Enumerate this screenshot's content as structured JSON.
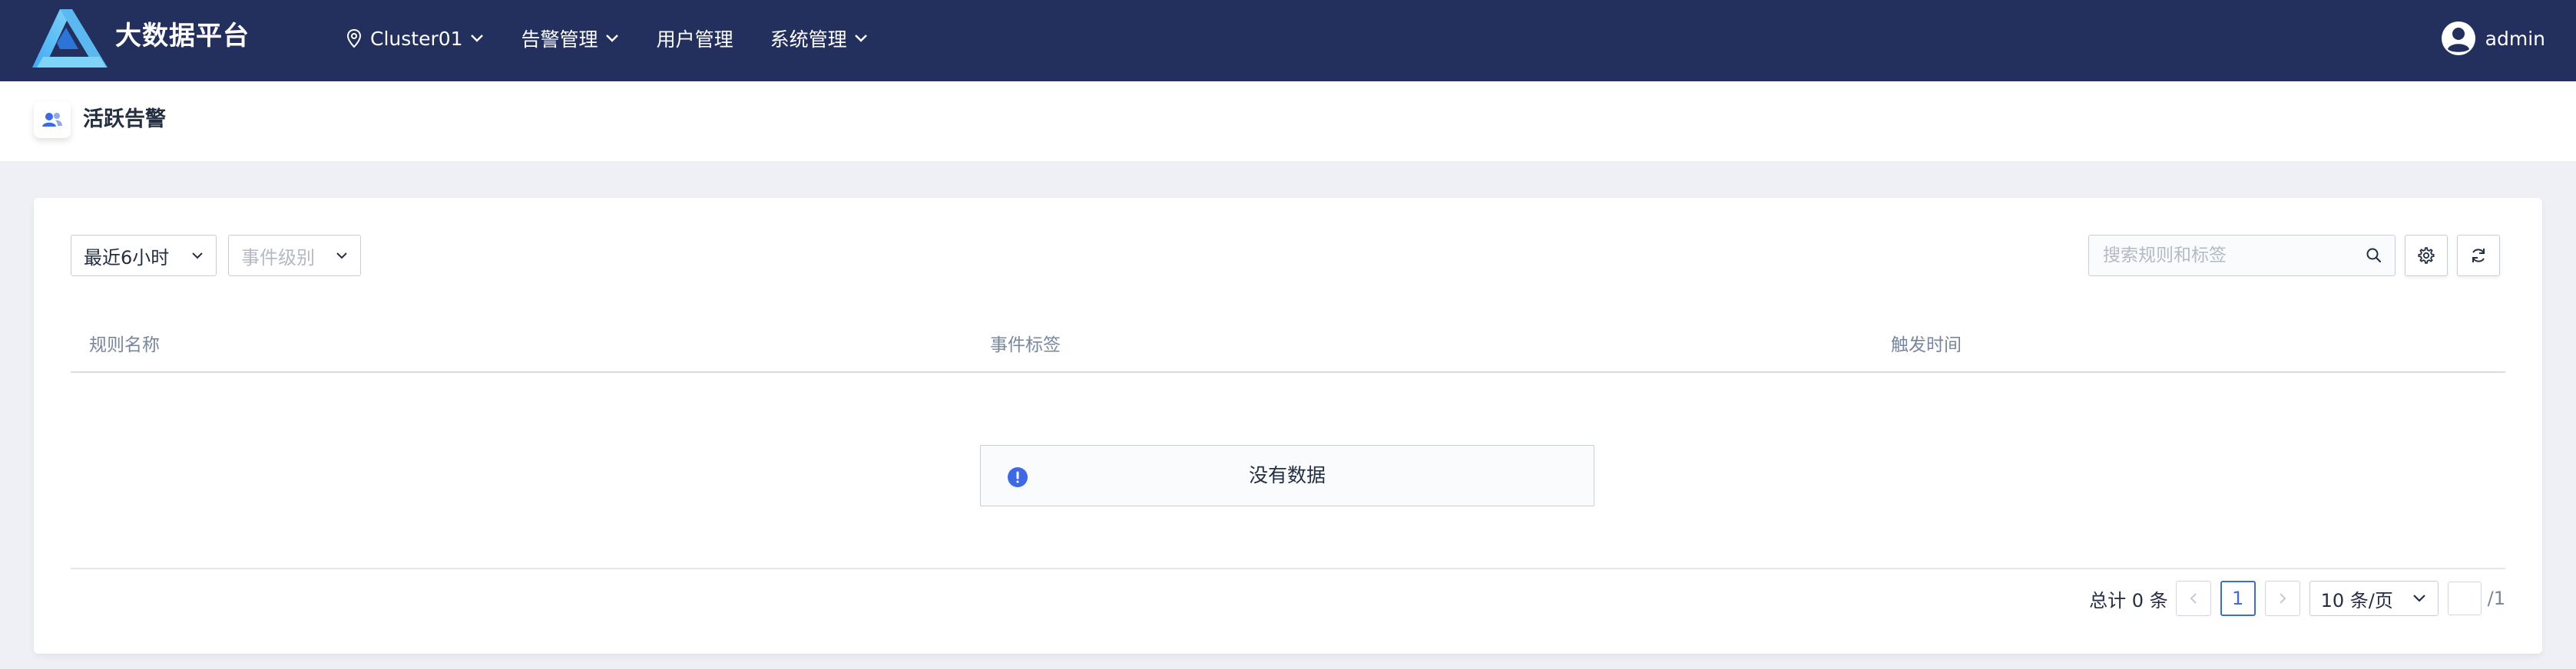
{
  "header": {
    "brand": "大数据平台",
    "nav": [
      {
        "label": "Cluster01",
        "icon": "location-pin-icon",
        "has_dropdown": true
      },
      {
        "label": "告警管理",
        "has_dropdown": true
      },
      {
        "label": "用户管理",
        "has_dropdown": false
      },
      {
        "label": "系统管理",
        "has_dropdown": true
      }
    ],
    "user": "admin"
  },
  "page": {
    "title": "活跃告警",
    "icon": "users-icon"
  },
  "filters": {
    "time_range": "最近6小时",
    "event_level_placeholder": "事件级别",
    "search_placeholder": "搜索规则和标签"
  },
  "table": {
    "columns": [
      "规则名称",
      "事件标签",
      "触发时间"
    ],
    "rows": [],
    "empty_text": "没有数据"
  },
  "pagination": {
    "total_label": "总计 0 条",
    "current_page": "1",
    "page_size": "10 条/页",
    "page_count": "/1"
  },
  "colors": {
    "topbar": "#232f5c",
    "accent": "#3e68e4",
    "background": "#eef0f5"
  }
}
